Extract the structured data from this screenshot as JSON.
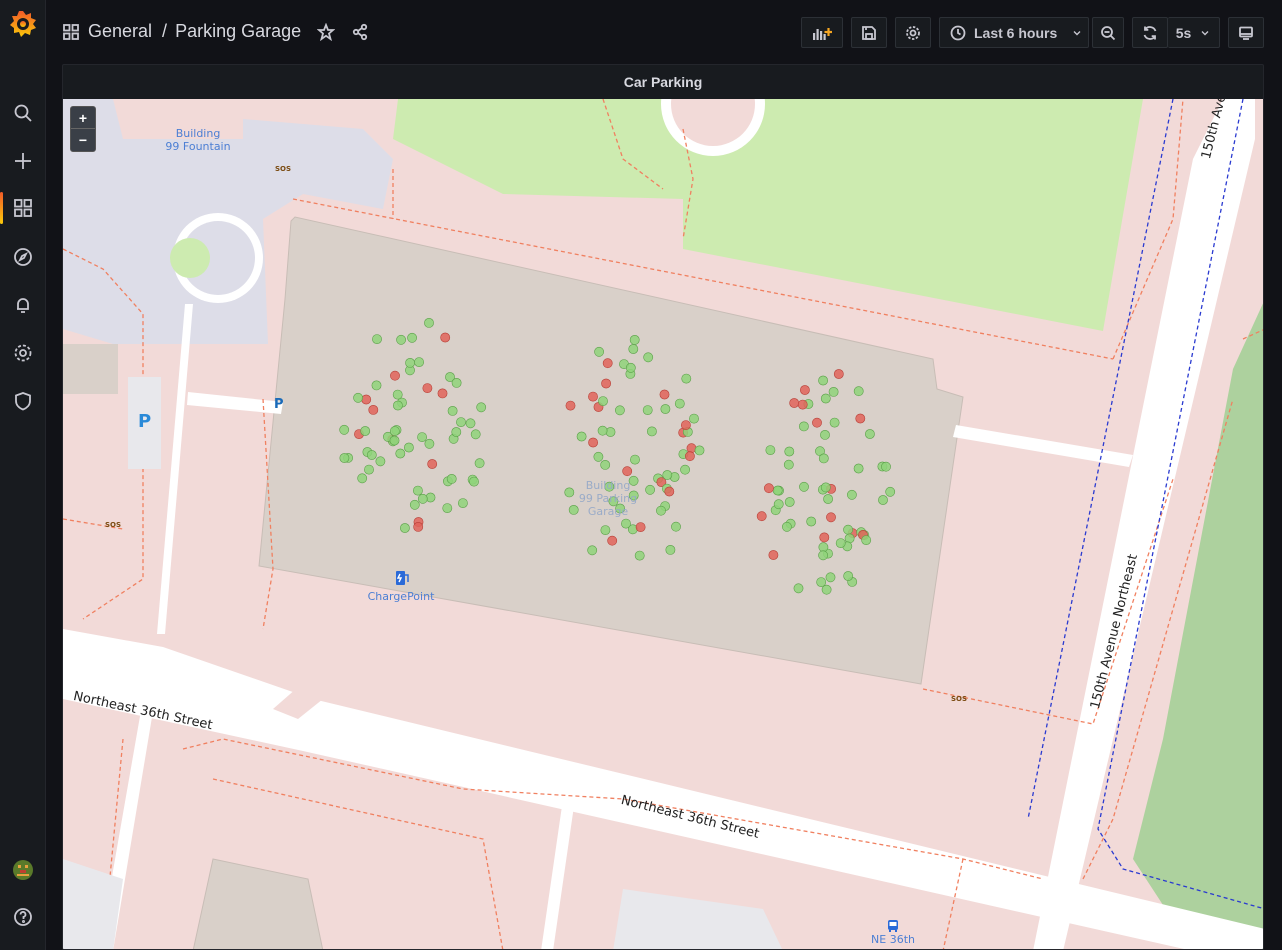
{
  "breadcrumb": {
    "folder": "General",
    "separator": "/",
    "dashboard": "Parking Garage"
  },
  "toolbar": {
    "time_range": "Last 6 hours",
    "refresh_interval": "5s"
  },
  "panel": {
    "title": "Car Parking"
  },
  "map": {
    "zoom_in": "+",
    "zoom_out": "−",
    "labels": {
      "fountain": "Building\n99 Fountain",
      "garage": "Building\n99 Parking\nGarage",
      "chargepoint": "ChargePoint",
      "street_ne36_left": "Northeast 36th Street",
      "street_ne36_right": "Northeast 36th Street",
      "avenue_150": "150th Avenue Northeast",
      "avenue_150_top": "150th Ave",
      "bus_stop": "NE 36th",
      "parking": "P",
      "sos": "SOS"
    },
    "colors": {
      "free": "#8fd37a",
      "occupied": "#e0645a"
    },
    "occupied_share": 0.18
  },
  "icons": [
    "grafana-logo",
    "search-icon",
    "plus-icon",
    "dashboards-icon",
    "explore-icon",
    "bell-icon",
    "gear-icon",
    "shield-icon",
    "avatar",
    "help-icon",
    "star-icon",
    "share-icon",
    "add-panel-icon",
    "save-icon",
    "settings-icon",
    "clock-icon",
    "chevron-down-icon",
    "zoom-out-icon",
    "refresh-icon",
    "tv-icon"
  ]
}
